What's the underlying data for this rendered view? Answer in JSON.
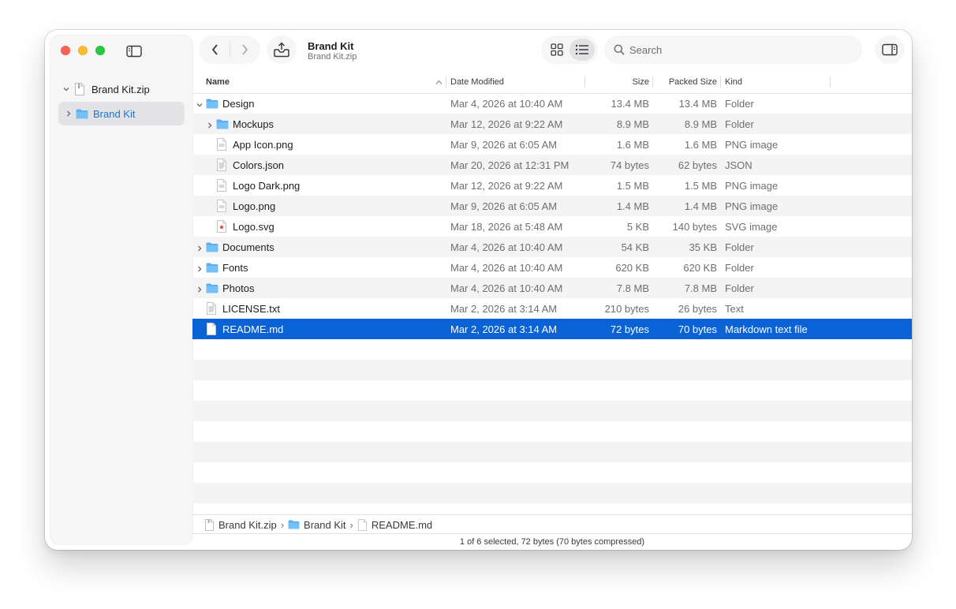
{
  "window": {
    "title": "Brand Kit",
    "subtitle": "Brand Kit.zip"
  },
  "sidebar": {
    "root_label": "Brand Kit.zip",
    "child_label": "Brand Kit"
  },
  "toolbar": {
    "search_placeholder": "Search"
  },
  "columns": {
    "name": "Name",
    "date": "Date Modified",
    "size": "Size",
    "packed": "Packed Size",
    "kind": "Kind"
  },
  "rows": [
    {
      "name": "Design",
      "date": "Mar 4, 2026 at 10:40 AM",
      "size": "13.4 MB",
      "packed": "13.4 MB",
      "kind": "Folder",
      "icon": "folder-icon",
      "disclosure": "expanded",
      "indent": 0
    },
    {
      "name": "Mockups",
      "date": "Mar 12, 2026 at 9:22 AM",
      "size": "8.9 MB",
      "packed": "8.9 MB",
      "kind": "Folder",
      "icon": "folder-icon",
      "disclosure": "collapsed",
      "indent": 1
    },
    {
      "name": "App Icon.png",
      "date": "Mar 9, 2026 at 6:05 AM",
      "size": "1.6 MB",
      "packed": "1.6 MB",
      "kind": "PNG image",
      "icon": "image-file-icon",
      "disclosure": "none",
      "indent": 1
    },
    {
      "name": "Colors.json",
      "date": "Mar 20, 2026 at 12:31 PM",
      "size": "74 bytes",
      "packed": "62 bytes",
      "kind": "JSON",
      "icon": "text-file-icon",
      "disclosure": "none",
      "indent": 1
    },
    {
      "name": "Logo Dark.png",
      "date": "Mar 12, 2026 at 9:22 AM",
      "size": "1.5 MB",
      "packed": "1.5 MB",
      "kind": "PNG image",
      "icon": "image-file-icon",
      "disclosure": "none",
      "indent": 1
    },
    {
      "name": "Logo.png",
      "date": "Mar 9, 2026 at 6:05 AM",
      "size": "1.4 MB",
      "packed": "1.4 MB",
      "kind": "PNG image",
      "icon": "image-file-icon",
      "disclosure": "none",
      "indent": 1
    },
    {
      "name": "Logo.svg",
      "date": "Mar 18, 2026 at 5:48 AM",
      "size": "5 KB",
      "packed": "140 bytes",
      "kind": "SVG image",
      "icon": "svg-file-icon",
      "disclosure": "none",
      "indent": 1
    },
    {
      "name": "Documents",
      "date": "Mar 4, 2026 at 10:40 AM",
      "size": "54 KB",
      "packed": "35 KB",
      "kind": "Folder",
      "icon": "folder-icon",
      "disclosure": "collapsed",
      "indent": 0
    },
    {
      "name": "Fonts",
      "date": "Mar 4, 2026 at 10:40 AM",
      "size": "620 KB",
      "packed": "620 KB",
      "kind": "Folder",
      "icon": "folder-icon",
      "disclosure": "collapsed",
      "indent": 0
    },
    {
      "name": "Photos",
      "date": "Mar 4, 2026 at 10:40 AM",
      "size": "7.8 MB",
      "packed": "7.8 MB",
      "kind": "Folder",
      "icon": "folder-icon",
      "disclosure": "collapsed",
      "indent": 0
    },
    {
      "name": "LICENSE.txt",
      "date": "Mar 2, 2026 at 3:14 AM",
      "size": "210 bytes",
      "packed": "26 bytes",
      "kind": "Text",
      "icon": "text-file-icon",
      "disclosure": "none",
      "indent": 0
    },
    {
      "name": "README.md",
      "date": "Mar 2, 2026 at 3:14 AM",
      "size": "72 bytes",
      "packed": "70 bytes",
      "kind": "Markdown text file",
      "icon": "document-icon",
      "disclosure": "none",
      "indent": 0,
      "selected": true
    }
  ],
  "pathbar": {
    "items": [
      "Brand Kit.zip",
      "Brand Kit",
      "README.md"
    ]
  },
  "status": {
    "text": "1 of 6 selected, 72 bytes (70 bytes compressed)"
  },
  "colors": {
    "selection": "#0a63d6",
    "folder": "#5ab0f2",
    "accent_text": "#1a73d9"
  }
}
